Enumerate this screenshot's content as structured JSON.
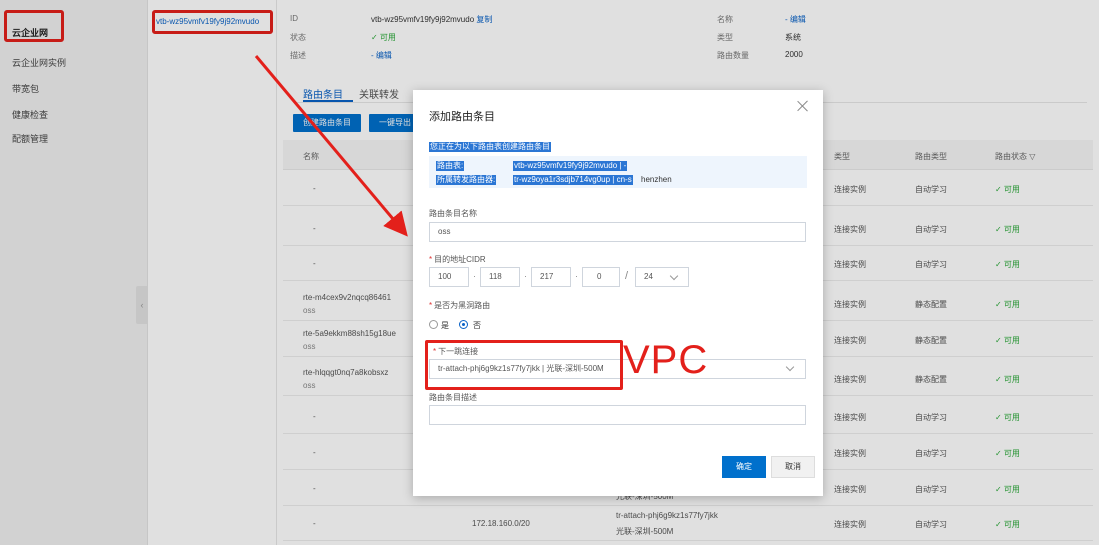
{
  "sidebar": {
    "items": [
      {
        "label": "云企业网",
        "active": true
      },
      {
        "label": "云企业网实例"
      },
      {
        "label": "带宽包"
      },
      {
        "label": "健康检查"
      },
      {
        "label": "配额管理"
      }
    ]
  },
  "list": {
    "selected": "vtb-wz95vmfv19fy9j92mvudo"
  },
  "detail": {
    "id_label": "ID",
    "id_value": "vtb-wz95vmfv19fy9j92mvudo",
    "copy_label": "复制",
    "status_label": "状态",
    "status_value": "✓ 可用",
    "desc_label": "描述",
    "desc_value": "- 编辑",
    "name_label": "名称",
    "name_value": "- 编辑",
    "type_label": "类型",
    "type_value": "系统",
    "count_label": "路由数量",
    "count_value": "2000"
  },
  "tabs": [
    {
      "label": "路由条目",
      "active": true
    },
    {
      "label": "关联转发"
    }
  ],
  "toolbar": {
    "add_label": "创建路由条目",
    "export_label": "一键导出"
  },
  "table": {
    "headers": {
      "name": "名称",
      "type": "类型",
      "route_type": "路由类型",
      "status": "路由状态"
    },
    "rows": [
      {
        "name": "-",
        "sub": "",
        "type": "连接实例",
        "route_type": "自动学习",
        "status": "✓ 可用"
      },
      {
        "name": "-",
        "sub": "",
        "type": "连接实例",
        "route_type": "自动学习",
        "status": "✓ 可用"
      },
      {
        "name": "-",
        "sub": "",
        "type": "连接实例",
        "route_type": "自动学习",
        "status": "✓ 可用"
      },
      {
        "name": "rte-m4cex9v2nqcq86461",
        "sub": "oss",
        "type": "连接实例",
        "route_type": "静态配置",
        "status": "✓ 可用"
      },
      {
        "name": "rte-5a9ekkm88sh15g18ue",
        "sub": "oss",
        "type": "连接实例",
        "route_type": "静态配置",
        "status": "✓ 可用"
      },
      {
        "name": "rte-hlqqgt0nq7a8kobsxz",
        "sub": "oss",
        "type": "连接实例",
        "route_type": "静态配置",
        "status": "✓ 可用"
      },
      {
        "name": "-",
        "sub": "",
        "type": "连接实例",
        "route_type": "自动学习",
        "status": "✓ 可用"
      },
      {
        "name": "-",
        "sub": "",
        "type": "连接实例",
        "route_type": "自动学习",
        "status": "✓ 可用"
      },
      {
        "name": "-",
        "sub": "",
        "type": "连接实例",
        "route_type": "自动学习",
        "status": "✓ 可用",
        "next_hop_tail": "光联-深圳-500M"
      },
      {
        "name": "-",
        "sub": "",
        "cidr": "172.18.160.0/20",
        "next_hop": "tr-attach-phj6g9kz1s77fy7jkk",
        "next_hop_tail": "光联-深圳-500M",
        "type": "连接实例",
        "route_type": "自动学习",
        "status": "✓ 可用"
      }
    ]
  },
  "modal": {
    "title": "添加路由条目",
    "info_title": "您正在为以下路由表创建路由条目",
    "route_table_label": "路由表:",
    "route_table_value": "vtb-wz95vmfv19fy9j92mvudo | -",
    "router_label": "所属转发路由器:",
    "router_value": "tr-wz9oya1r3sdjb714vg0up | cn-s",
    "router_tail": "henzhen",
    "name_label": "路由条目名称",
    "name_value": "oss",
    "cidr_label": "目的地址CIDR",
    "cidr": [
      "100",
      "118",
      "217",
      "0"
    ],
    "cidr_mask": "24",
    "blackhole_label": "是否为黑洞路由",
    "yes_label": "是",
    "no_label": "否",
    "next_hop_label": "下一跳连接",
    "next_hop_value": "tr-attach-phj6g9kz1s77fy7jkk | 光联-深圳-500M",
    "desc_label": "路由条目描述",
    "desc_value": "",
    "ok_label": "确定",
    "cancel_label": "取消",
    "annotation": "VPC"
  },
  "colors": {
    "highlight": "#e3201b",
    "primary": "#0070cc",
    "link": "#0a62c7"
  }
}
